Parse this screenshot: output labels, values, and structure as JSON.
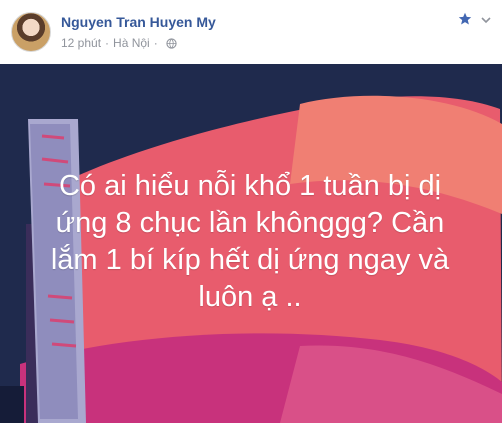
{
  "post": {
    "author_name": "Nguyen Tran Huyen My",
    "time": "12 phút",
    "location": "Hà Nội",
    "status_text": "Có ai hiểu nỗi khổ 1 tuần bị dị ứng 8 chục lần khônggg? Cần lắm 1 bí kíp hết dị ứng ngay và luôn ạ .."
  },
  "icons": {
    "privacy": "globe-icon",
    "favorite": "star-icon",
    "options": "chevron-down-icon"
  },
  "colors": {
    "author_link": "#365899",
    "meta_text": "#90949c",
    "star": "#4267b2",
    "background_navy": "#1f2a4d",
    "background_pink": "#e85c6d",
    "background_magenta": "#c8327c"
  }
}
